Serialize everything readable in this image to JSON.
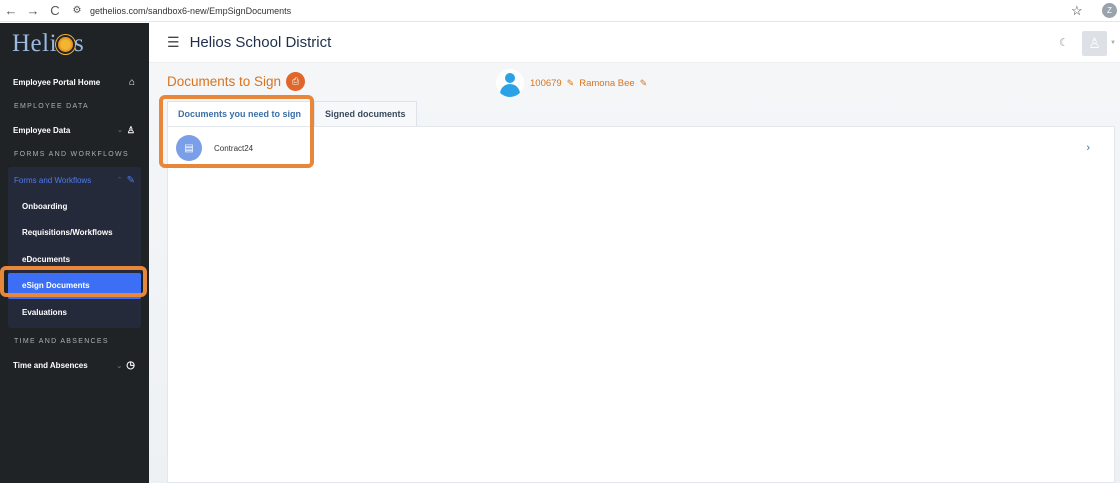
{
  "browser": {
    "back": "←",
    "forward": "→",
    "reload": "C",
    "url": "gethelios.com/sandbox6-new/EmpSignDocuments",
    "profile_initial": "Z"
  },
  "sidebar": {
    "logo_left": "Heli",
    "logo_right": "s",
    "items": [
      {
        "label": "Employee Portal Home"
      },
      {
        "label": "Employee Data"
      },
      {
        "label": "Time and Absences"
      }
    ],
    "sections": [
      "EMPLOYEE DATA",
      "FORMS AND WORKFLOWS",
      "TIME AND ABSENCES"
    ],
    "forms_group": {
      "label": "Forms and Workflows",
      "children": [
        "Onboarding",
        "Requisitions/Workflows",
        "eDocuments",
        "eSign Documents",
        "Evaluations"
      ],
      "active": "eSign Documents"
    }
  },
  "header": {
    "district": "Helios School District"
  },
  "main": {
    "title": "Documents to Sign",
    "employee_id": "100679",
    "employee_name": "Ramona Bee",
    "tabs": [
      {
        "label": "Documents you need to sign",
        "active": true
      },
      {
        "label": "Signed documents",
        "active": false
      }
    ],
    "documents": [
      {
        "name": "Contract24"
      }
    ]
  },
  "colors": {
    "accent_orange": "#d9731e",
    "highlight": "#e8873a",
    "sidebar_bg": "#1f2326",
    "active_blue": "#3c6ff5"
  }
}
